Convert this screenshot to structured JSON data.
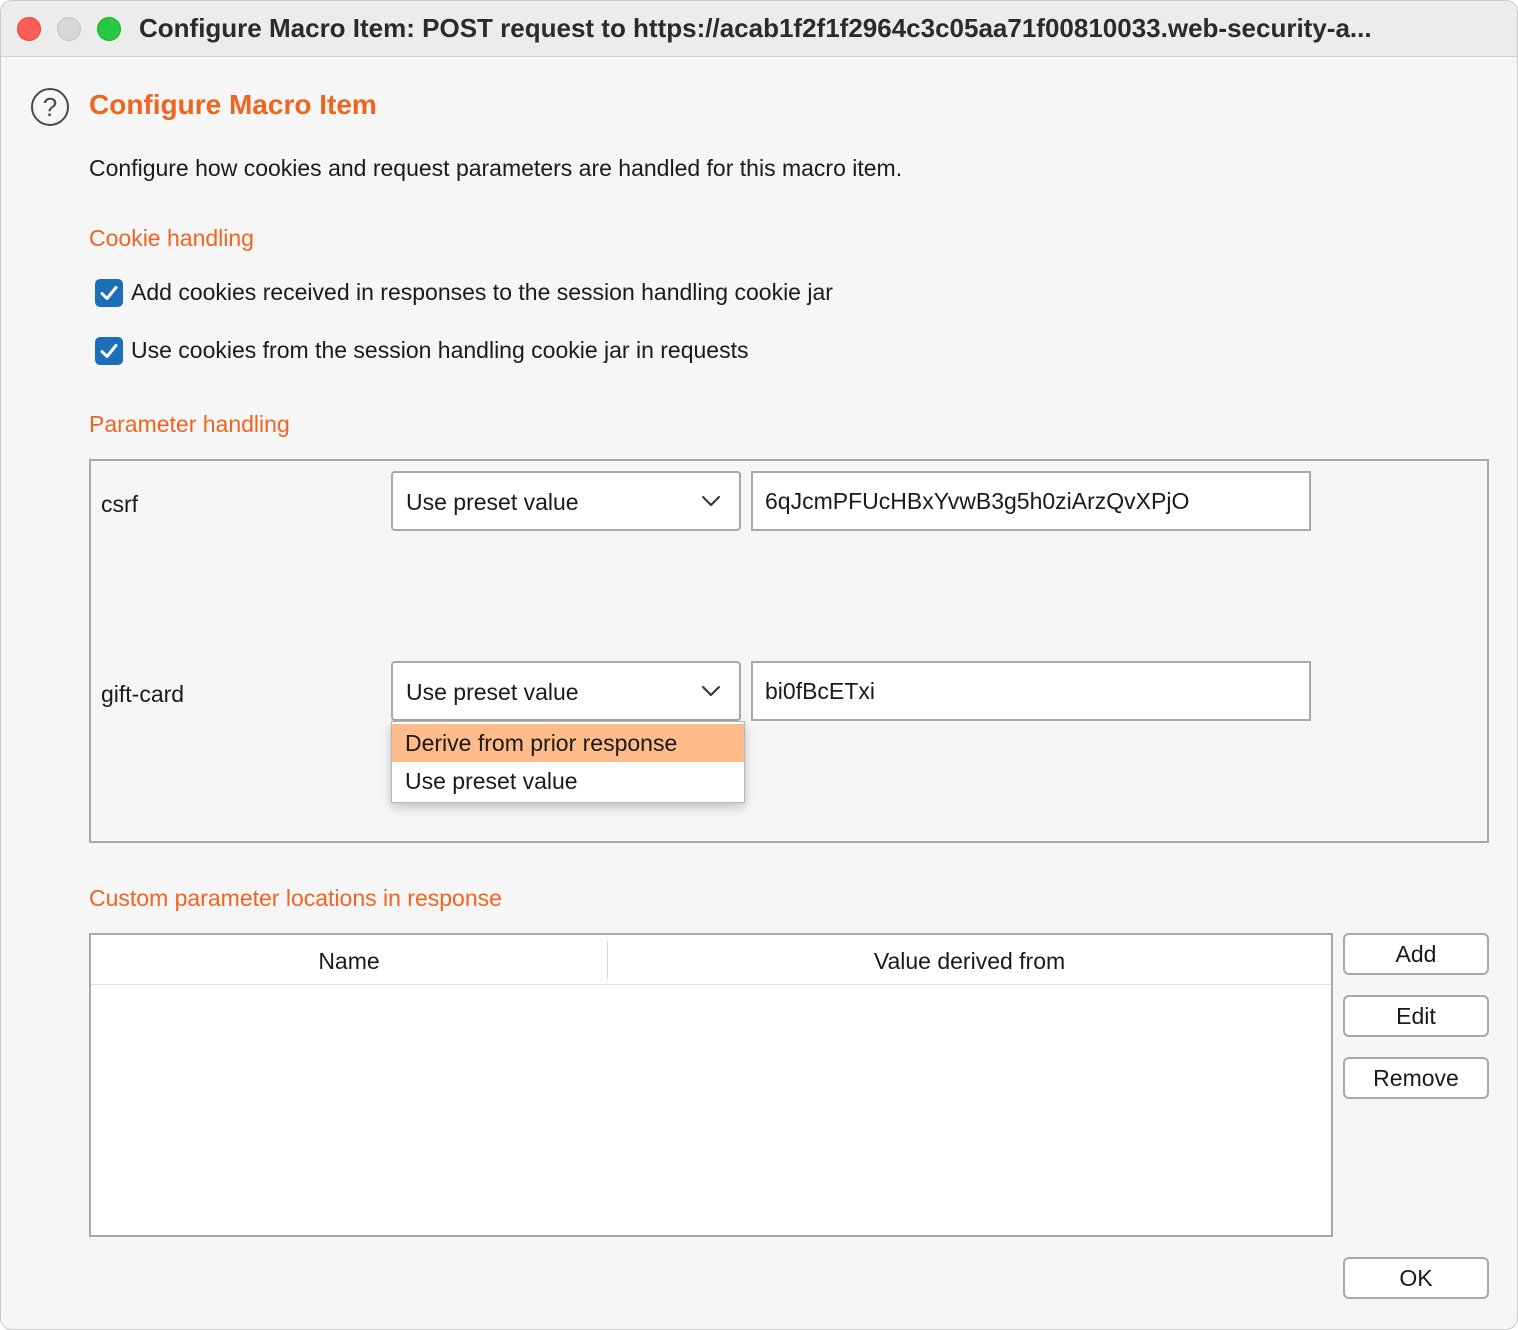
{
  "window": {
    "title": "Configure Macro Item: POST request to https://acab1f2f1f2964c3c05aa71f00810033.web-security-a..."
  },
  "header": {
    "help_icon": "?",
    "heading": "Configure Macro Item",
    "description": "Configure how cookies and request parameters are handled for this macro item."
  },
  "cookie_handling": {
    "title": "Cookie handling",
    "options": [
      {
        "label": "Add cookies received in responses to the session handling cookie jar",
        "checked": true
      },
      {
        "label": "Use cookies from the session handling cookie jar in requests",
        "checked": true
      }
    ]
  },
  "parameter_handling": {
    "title": "Parameter handling",
    "params": [
      {
        "name": "csrf",
        "mode": "Use preset value",
        "value": "6qJcmPFUcHBxYvwB3g5h0ziArzQvXPjO"
      },
      {
        "name": "gift-card",
        "mode": "Use preset value",
        "value": "bi0fBcETxi"
      }
    ],
    "dropdown_open": {
      "options": [
        "Derive from prior response",
        "Use preset value"
      ],
      "highlighted": "Derive from prior response"
    }
  },
  "custom_locations": {
    "title": "Custom parameter locations in response",
    "columns": [
      "Name",
      "Value derived from"
    ],
    "rows": []
  },
  "buttons": {
    "add": "Add",
    "edit": "Edit",
    "remove": "Remove",
    "ok": "OK"
  },
  "colors": {
    "accent": "#f06420",
    "checkbox": "#1b6fb8",
    "dropdown_highlight": "#ffbc8a"
  }
}
